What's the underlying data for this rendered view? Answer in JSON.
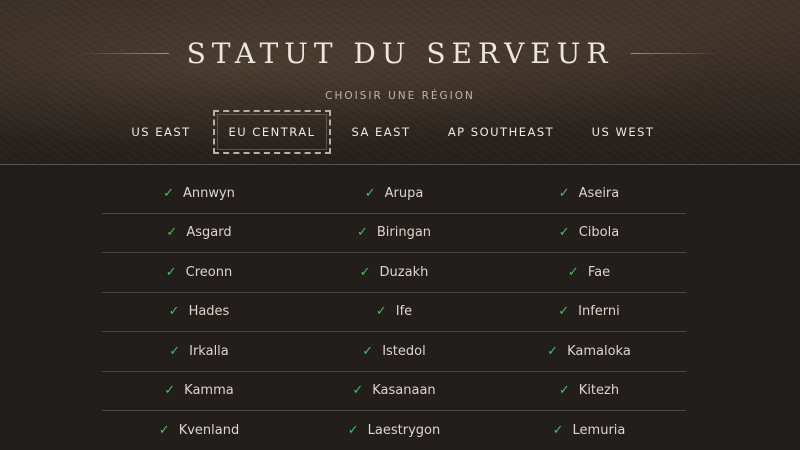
{
  "header": {
    "title": "STATUT DU SERVEUR",
    "subtitle": "CHOISIR UNE RÉGION"
  },
  "regions": [
    {
      "label": "US EAST",
      "active": false
    },
    {
      "label": "EU CENTRAL",
      "active": true
    },
    {
      "label": "SA EAST",
      "active": false
    },
    {
      "label": "AP SOUTHEAST",
      "active": false
    },
    {
      "label": "US WEST",
      "active": false
    }
  ],
  "status_icon": "check-icon",
  "colors": {
    "status_ok": "#3fc45a",
    "background": "#221e1b",
    "text": "#ddd6cd"
  },
  "servers": [
    [
      "Annwyn",
      "Arupa",
      "Aseira"
    ],
    [
      "Asgard",
      "Biringan",
      "Cibola"
    ],
    [
      "Creonn",
      "Duzakh",
      "Fae"
    ],
    [
      "Hades",
      "Ife",
      "Inferni"
    ],
    [
      "Irkalla",
      "Istedol",
      "Kamaloka"
    ],
    [
      "Kamma",
      "Kasanaan",
      "Kitezh"
    ],
    [
      "Kvenland",
      "Laestrygon",
      "Lemuria"
    ]
  ]
}
